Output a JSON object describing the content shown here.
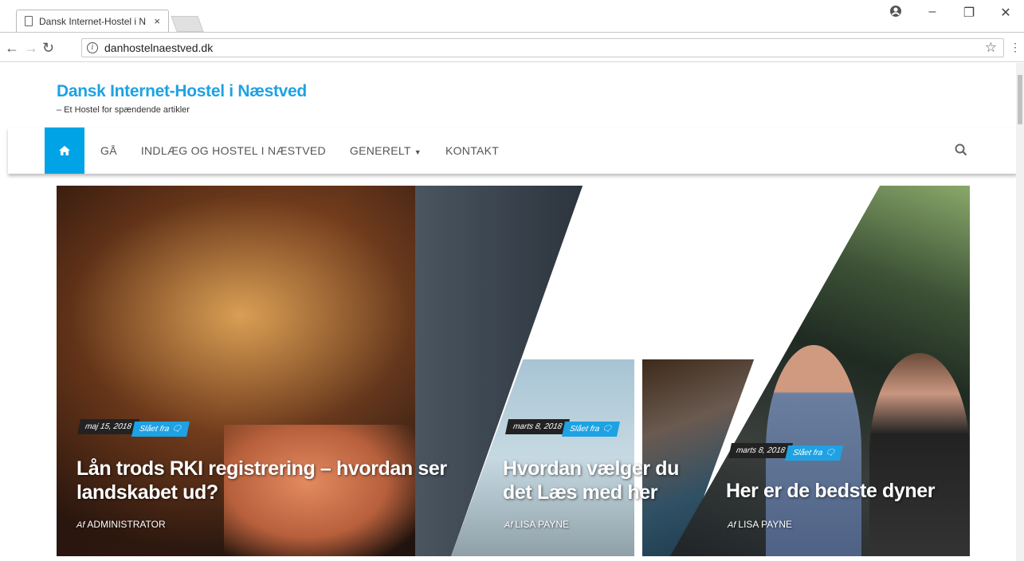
{
  "browser": {
    "tab_title": "Dansk Internet-Hostel i N",
    "tab_close": "×",
    "url": "danhostelnaestved.dk",
    "controls": {
      "minimize": "–",
      "restore": "❐",
      "close": "✕"
    }
  },
  "site": {
    "title": "Dansk Internet-Hostel i Næstved",
    "tagline": "– Et Hostel for spændende artikler"
  },
  "nav": {
    "items": [
      {
        "label": "GÅ"
      },
      {
        "label": "INDLÆG OG HOSTEL I NÆSTVED"
      },
      {
        "label": "GENERELT"
      },
      {
        "label": "KONTAKT"
      }
    ]
  },
  "slides": [
    {
      "date": "maj 15, 2018",
      "comments": "Slået fra",
      "title": "Lån trods RKI registrering – hvordan ser landskabet ud?",
      "author_prefix": "Af",
      "author": "ADMINISTRATOR"
    },
    {
      "date": "marts 8, 2018",
      "comments": "Slået fra",
      "title": "Hvordan vælger du det Læs med her",
      "author_prefix": "Af",
      "author": "LISA PAYNE"
    },
    {
      "date": "marts 8, 2018",
      "comments": "Slået fra",
      "title": "Her er de bedste dyner",
      "author_prefix": "Af",
      "author": "LISA PAYNE"
    }
  ],
  "colors": {
    "accent": "#1ea2e3",
    "home": "#00a4e6"
  }
}
